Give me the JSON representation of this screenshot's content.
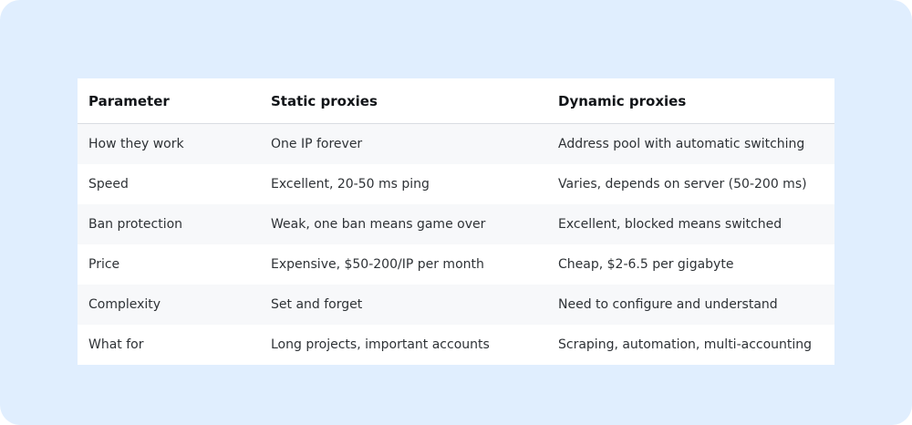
{
  "table": {
    "headers": [
      "Parameter",
      "Static proxies",
      "Dynamic proxies"
    ],
    "rows": [
      [
        "How they work",
        "One IP forever",
        "Address pool with automatic switching"
      ],
      [
        "Speed",
        "Excellent, 20-50 ms ping",
        "Varies, depends on server (50-200 ms)"
      ],
      [
        "Ban protection",
        "Weak, one ban means game over",
        "Excellent, blocked means switched"
      ],
      [
        "Price",
        "Expensive, $50-200/IP per month",
        "Cheap, $2-6.5 per gigabyte"
      ],
      [
        "Complexity",
        "Set and forget",
        "Need to configure and understand"
      ],
      [
        "What for",
        "Long projects, important accounts",
        "Scraping, automation, multi-accounting"
      ]
    ]
  },
  "colors": {
    "background": "#e0eefe",
    "table_bg": "#ffffff",
    "row_stripe": "#f7f8fa"
  }
}
